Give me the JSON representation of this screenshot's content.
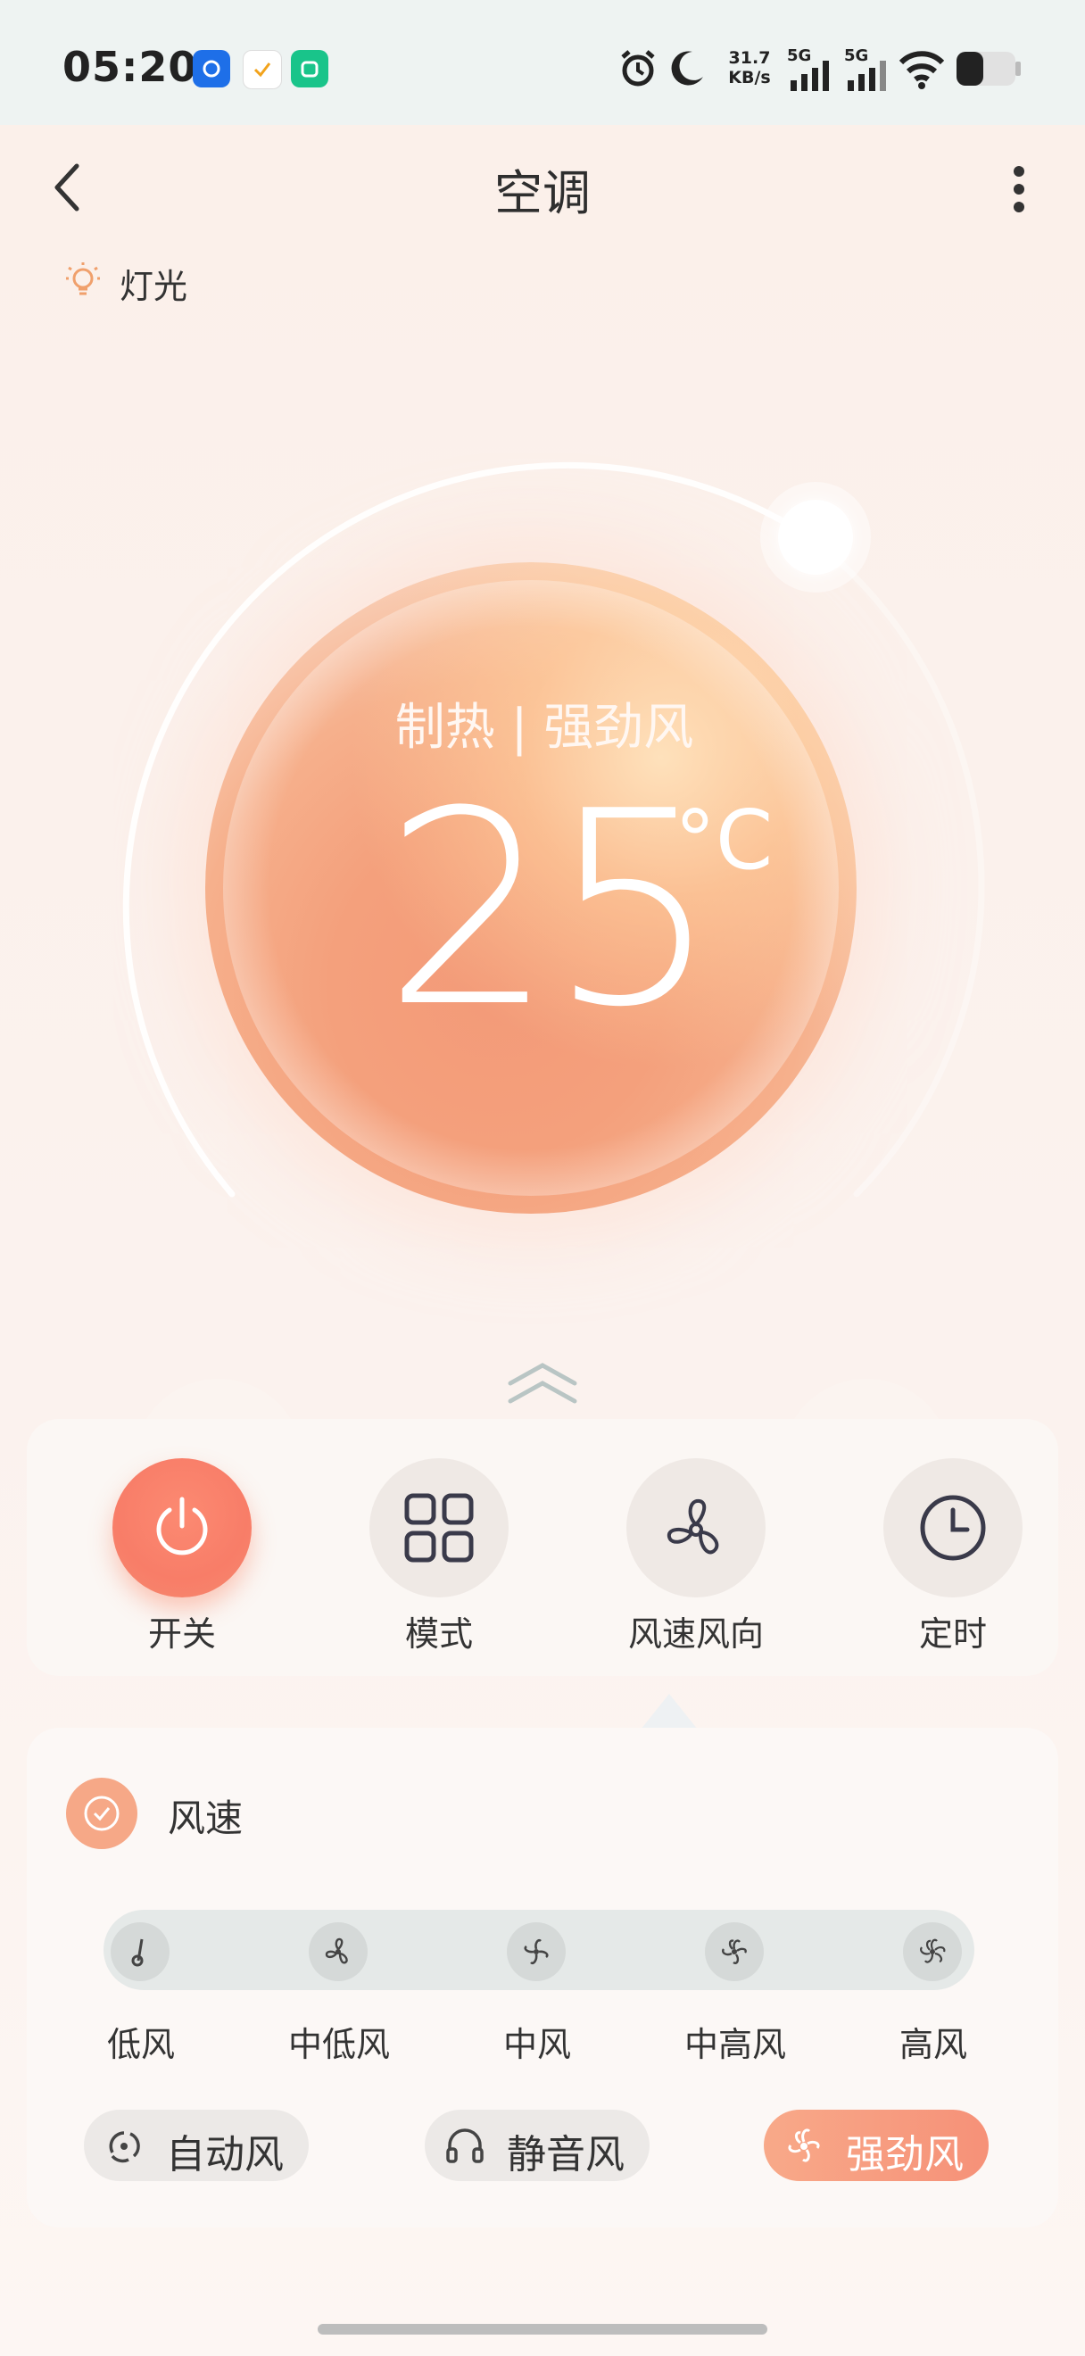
{
  "status_bar": {
    "time": "05:20",
    "net_speed_value": "31.7",
    "net_speed_unit": "KB/s",
    "signal_1": "5G",
    "signal_2": "5G",
    "icons": [
      "alarm-icon",
      "moon-icon",
      "wifi-icon",
      "battery-icon"
    ],
    "app_badges": [
      "blue-app-icon",
      "check-app-icon",
      "green-app-icon"
    ]
  },
  "header": {
    "title": "空调"
  },
  "light": {
    "label": "灯光"
  },
  "dial": {
    "mode_text": "制热 | 强劲风",
    "temperature": "25",
    "unit": "°C"
  },
  "controls": [
    {
      "label": "开关",
      "icon": "power-icon",
      "active": true
    },
    {
      "label": "模式",
      "icon": "grid-icon",
      "active": false
    },
    {
      "label": "风速风向",
      "icon": "fan-icon",
      "active": false
    },
    {
      "label": "定时",
      "icon": "clock-icon",
      "active": false
    }
  ],
  "fan_speed": {
    "title": "风速",
    "levels": [
      "低风",
      "中低风",
      "中风",
      "中高风",
      "高风"
    ],
    "presets": [
      "自动风",
      "静音风",
      "强劲风"
    ],
    "selected_preset": "强劲风"
  },
  "colors": {
    "accent": "#f6937a",
    "orb": "#f4a07c",
    "background": "#fbf1ec"
  }
}
